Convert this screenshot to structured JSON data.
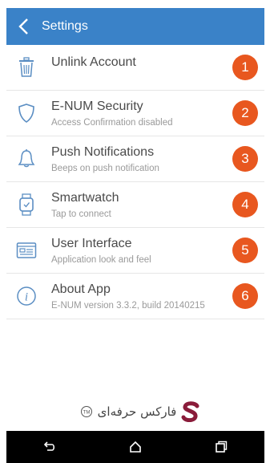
{
  "header": {
    "title": "Settings",
    "back_icon": "chevron-left-icon"
  },
  "accent_color": "#3a82c8",
  "badge_color": "#e8571f",
  "items": [
    {
      "title": "Unlink Account",
      "subtitle": "",
      "icon": "trash-icon",
      "badge": "1"
    },
    {
      "title": "E-NUM Security",
      "subtitle": "Access Confirmation disabled",
      "icon": "shield-icon",
      "badge": "2"
    },
    {
      "title": "Push Notifications",
      "subtitle": "Beeps on push notification",
      "icon": "bell-icon",
      "badge": "3"
    },
    {
      "title": "Smartwatch",
      "subtitle": "Tap to connect",
      "icon": "smartwatch-icon",
      "badge": "4"
    },
    {
      "title": "User Interface",
      "subtitle": "Application look and feel",
      "icon": "window-icon",
      "badge": "5"
    },
    {
      "title": "About App",
      "subtitle": "E-NUM version 3.3.2, build 20140215",
      "icon": "info-icon",
      "badge": "6"
    }
  ],
  "watermark": {
    "text": "فارکس حرفه‌ای",
    "mark": "TM"
  },
  "navbar": {
    "buttons": [
      "back-icon",
      "home-icon",
      "recents-icon"
    ]
  }
}
